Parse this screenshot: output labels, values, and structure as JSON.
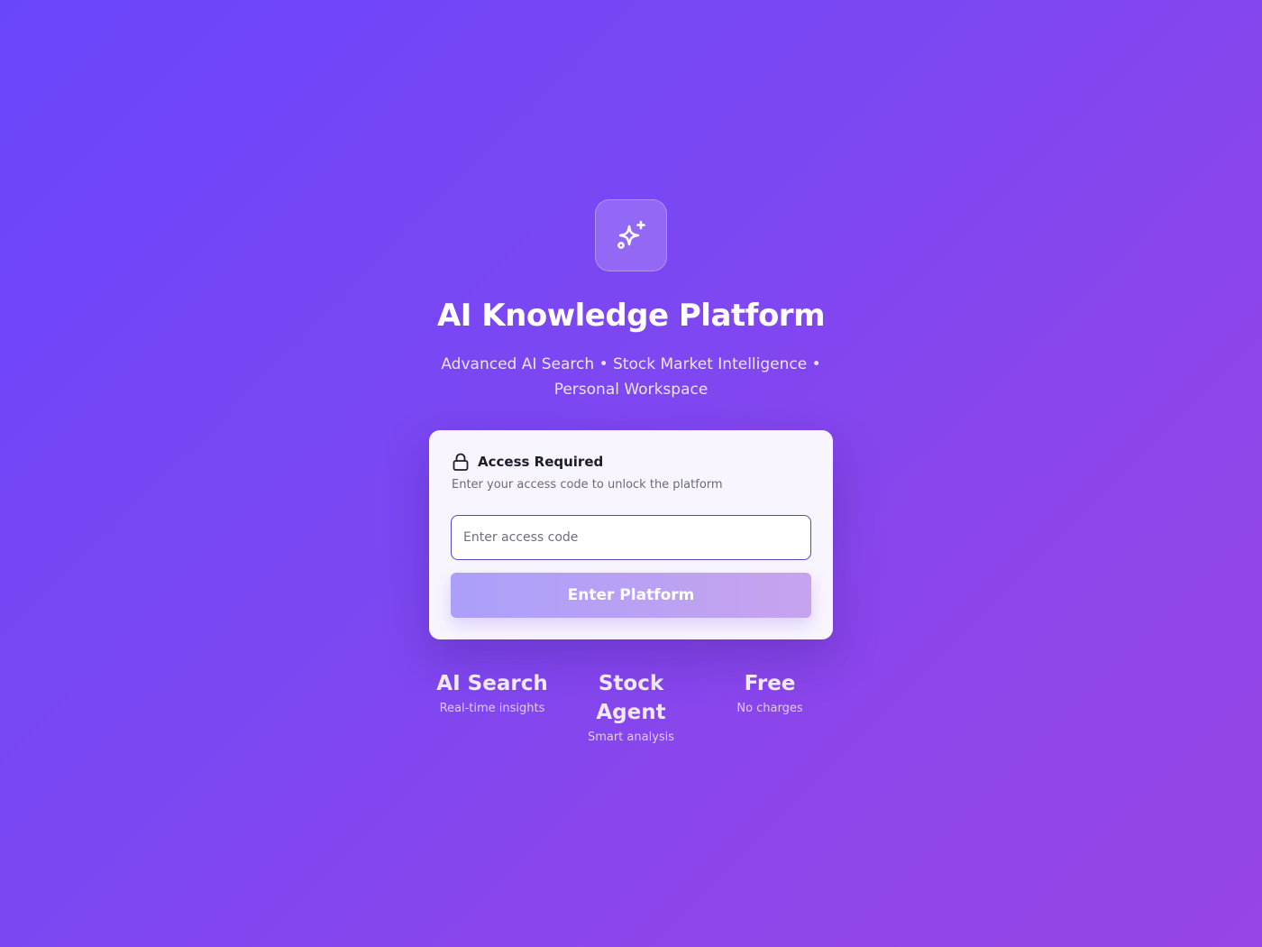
{
  "brand": {
    "icon": "sparkles-icon",
    "title": "AI Knowledge Platform",
    "subtitle": "Advanced AI Search • Stock Market Intelligence • Personal Workspace"
  },
  "access_card": {
    "icon": "lock-icon",
    "title": "Access Required",
    "description": "Enter your access code to unlock the platform",
    "input_value": "",
    "input_placeholder": "Enter access code",
    "submit_label": "Enter Platform"
  },
  "features": [
    {
      "title": "AI Search",
      "subtitle": "Real-time insights"
    },
    {
      "title": "Stock Agent",
      "subtitle": "Smart analysis"
    },
    {
      "title": "Free",
      "subtitle": "No charges"
    }
  ],
  "colors": {
    "background_start": "#6a46fb",
    "background_end": "#9645e6",
    "input_border": "#5547c7",
    "button_start": "#ab9ff9",
    "button_end": "#c7a3ef"
  }
}
